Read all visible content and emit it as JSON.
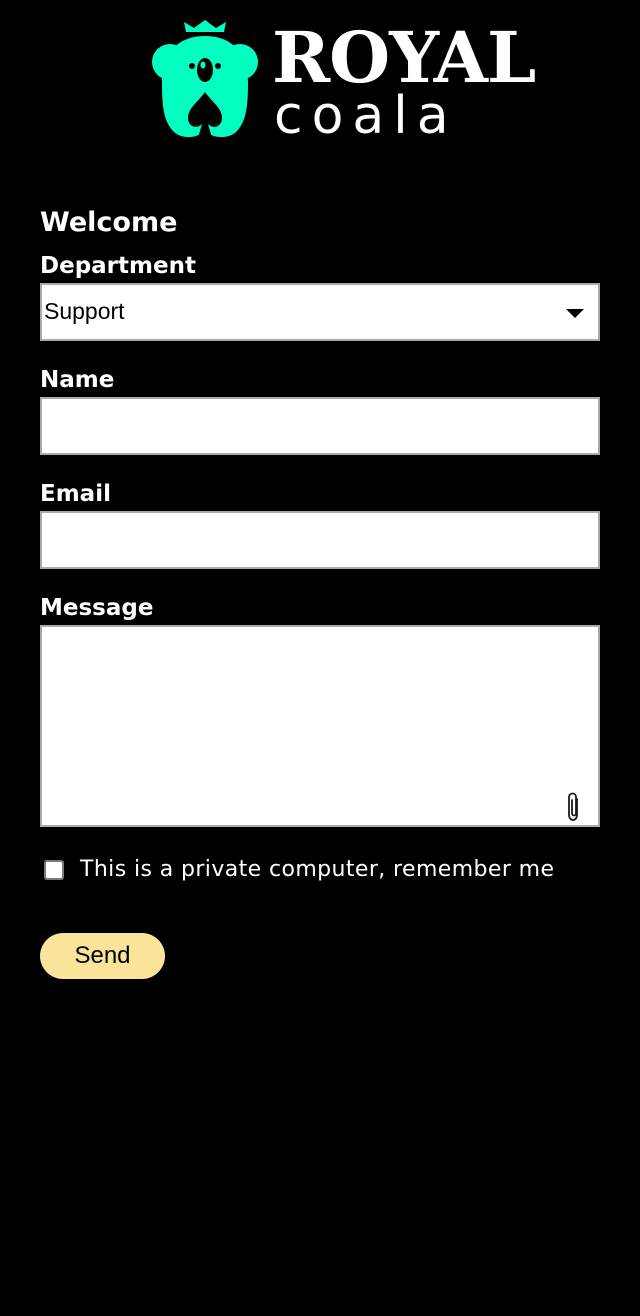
{
  "brand": {
    "name_top": "ROYAL",
    "name_bottom": "coala",
    "logo_icon": "koala-crown-icon",
    "accent_color": "#00ffc0"
  },
  "form": {
    "title": "Welcome",
    "department": {
      "label": "Department",
      "selected": "Support",
      "icon": "chevron-down-icon"
    },
    "name": {
      "label": "Name",
      "value": ""
    },
    "email": {
      "label": "Email",
      "value": ""
    },
    "message": {
      "label": "Message",
      "value": "",
      "attach_icon": "paperclip-icon"
    },
    "remember": {
      "label": "This is a private computer, remember me",
      "checked": false
    },
    "send_label": "Send",
    "send_color": "#f9e49a"
  },
  "theme": {
    "background": "#000000",
    "text": "#ffffff",
    "field_border": "#a9a9a9"
  }
}
